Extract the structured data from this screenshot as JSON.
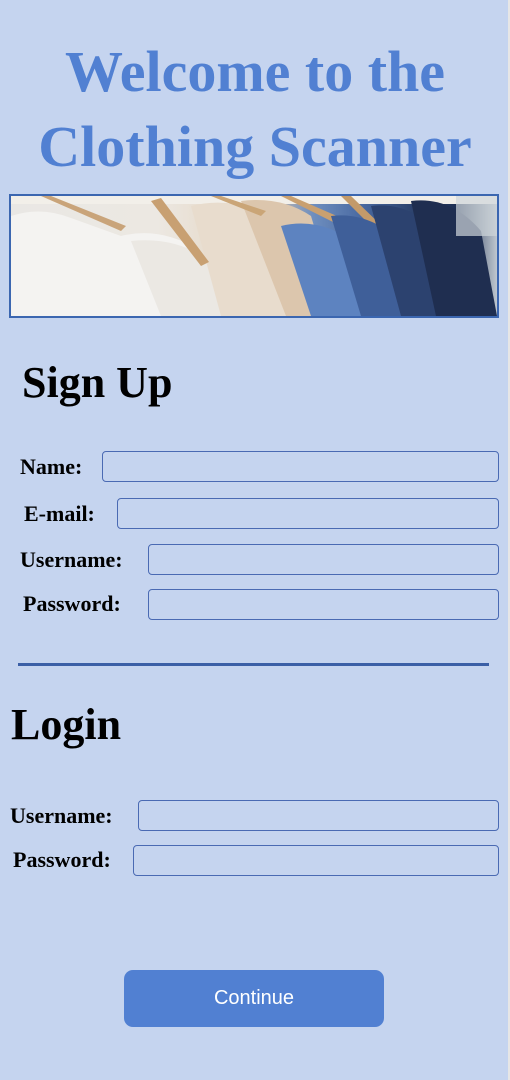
{
  "header": {
    "title_line1": "Welcome to the",
    "title_line2": "Clothing Scanner"
  },
  "banner": {
    "image": "clothes-on-hangers-photo"
  },
  "signup": {
    "heading": "Sign Up",
    "name_label": "Name:",
    "email_label": "E-mail:",
    "username_label": "Username:",
    "password_label": "Password:",
    "name_value": "",
    "email_value": "",
    "username_value": "",
    "password_value": ""
  },
  "login": {
    "heading": "Login",
    "username_label": "Username:",
    "password_label": "Password:",
    "username_value": "",
    "password_value": ""
  },
  "actions": {
    "continue_label": "Continue"
  },
  "colors": {
    "background": "#c5d4ef",
    "title": "#5180d2",
    "border": "#3b66b0",
    "button": "#5180d2",
    "button_text": "#ffffff"
  }
}
